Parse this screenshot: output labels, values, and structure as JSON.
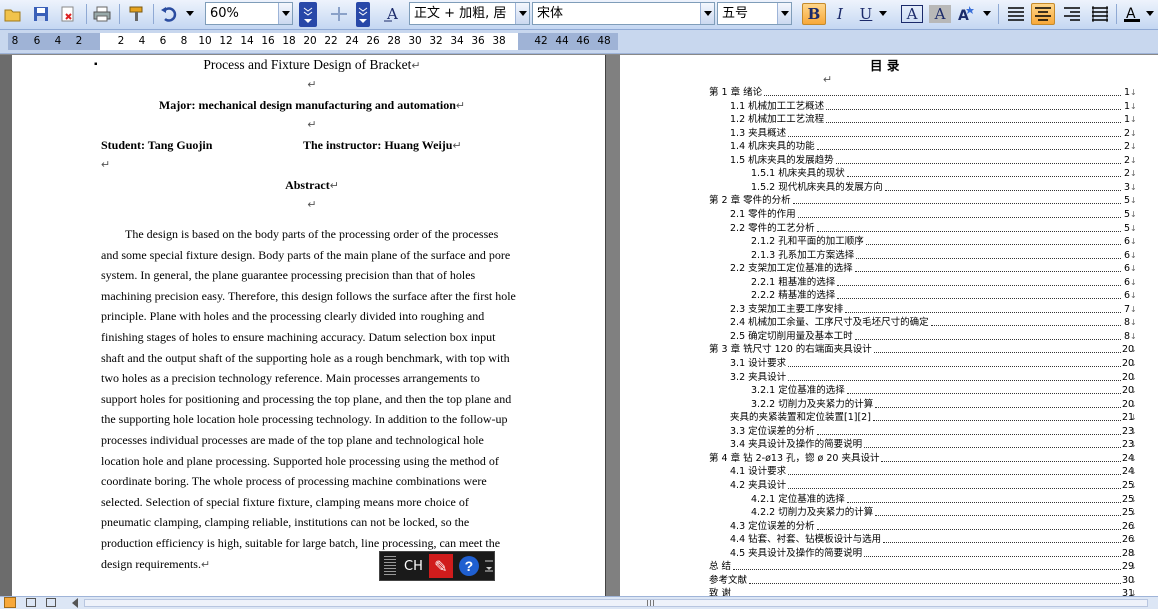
{
  "toolbar": {
    "zoom": "60%",
    "style": "正文 + 加粗, 居",
    "font": "宋体",
    "size": "五号",
    "bold_label": "B",
    "italic_label": "I",
    "underline_label": "U",
    "char_border_label": "A",
    "char_shade_label": "A",
    "font_color_label": "A"
  },
  "ruler": {
    "ticks": [
      "8",
      "6",
      "4",
      "2",
      "2",
      "4",
      "6",
      "8",
      "10",
      "12",
      "14",
      "16",
      "18",
      "20",
      "22",
      "24",
      "26",
      "28",
      "30",
      "32",
      "34",
      "36",
      "38",
      "42",
      "44",
      "46",
      "48"
    ]
  },
  "left_page": {
    "bullet": "▪",
    "title": "Process and Fixture Design of   Bracket",
    "major": "Major: mechanical design manufacturing and automation",
    "student": "Student: Tang Guojin",
    "instructor": "The instructor: Huang Weiju",
    "abstract_heading": "Abstract",
    "para_mark": "↵",
    "abstract_lines": [
      "The design is based on the body parts of the processing order of the processes",
      "and some special fixture design. Body parts of the main plane of the surface and pore",
      "system. In general, the plane guarantee processing precision than that of holes",
      "machining precision easy. Therefore, this design follows the surface after the first hole",
      "principle. Plane with holes and the processing clearly divided into roughing and",
      "finishing stages of holes to ensure machining accuracy. Datum selection box input",
      "shaft and the output shaft of the supporting hole as a rough benchmark, with top with",
      "two holes as a precision technology reference. Main processes arrangements to",
      "support holes for positioning and processing the top plane, and then the top plane and",
      "the supporting hole location hole processing technology. In addition to the follow-up",
      "processes individual processes are made of the top plane and technological hole",
      "location hole and plane processing. Supported hole processing using the method of",
      "coordinate boring. The whole process of processing machine combinations were",
      "selected. Selection of special fixture fixture, clamping means more choice of",
      "pneumatic clamping, clamping reliable, institutions can not be locked, so the",
      "production efficiency is high, suitable for large batch, line processing, can meet the",
      "design requirements."
    ]
  },
  "right_page": {
    "toc_title": "目    录",
    "toc": [
      {
        "text": "第 1 章  绪论",
        "page": "1"
      },
      {
        "text": "1.1  机械加工工艺概述",
        "page": "1"
      },
      {
        "text": "1.2 机械加工工艺流程",
        "page": "1"
      },
      {
        "text": "1.3 夹具概述",
        "page": "2"
      },
      {
        "text": "1.4 机床夹具的功能",
        "page": "2"
      },
      {
        "text": "1.5 机床夹具的发展趋势",
        "page": "2"
      },
      {
        "text": "1.5.1 机床夹具的现状",
        "page": "2"
      },
      {
        "text": "1.5.2 现代机床夹具的发展方向",
        "page": "3"
      },
      {
        "text": "第 2 章  零件的分析",
        "page": "5"
      },
      {
        "text": "2.1  零件的作用",
        "page": "5"
      },
      {
        "text": "2.2  零件的工艺分析",
        "page": "5"
      },
      {
        "text": "2.1.2  孔和平面的加工顺序",
        "page": "6"
      },
      {
        "text": "2.1.3  孔系加工方案选择",
        "page": "6"
      },
      {
        "text": "2.2  支架加工定位基准的选择",
        "page": "6"
      },
      {
        "text": "2.2.1  粗基准的选择",
        "page": "6"
      },
      {
        "text": "2.2.2  精基准的选择",
        "page": "6"
      },
      {
        "text": "2.3  支架加工主要工序安排",
        "page": "7"
      },
      {
        "text": "2.4     机械加工余量、工序尺寸及毛坯尺寸的确定",
        "page": "8"
      },
      {
        "text": "2.5     确定切削用量及基本工时",
        "page": "8"
      },
      {
        "text": "第 3 章  铣尺寸 120 的右端面夹具设计",
        "page": "20"
      },
      {
        "text": "3.1 设计要求",
        "page": "20"
      },
      {
        "text": "3.2 夹具设计",
        "page": "20"
      },
      {
        "text": "3.2.1     定位基准的选择",
        "page": "20"
      },
      {
        "text": "3.2.2     切削力及夹紧力的计算",
        "page": "20"
      },
      {
        "text": "夹具的夹紧装置和定位装置[1][2]",
        "page": "21"
      },
      {
        "text": "3.3 定位误差的分析",
        "page": "23"
      },
      {
        "text": "3.4 夹具设计及操作的简要说明",
        "page": "23"
      },
      {
        "text": "第 4 章  钻 2-ø13 孔，锪 ø 20 夹具设计",
        "page": "24"
      },
      {
        "text": "4.1 设计要求",
        "page": "24"
      },
      {
        "text": "4.2 夹具设计",
        "page": "25"
      },
      {
        "text": "4.2.1     定位基准的选择",
        "page": "25"
      },
      {
        "text": "4.2.2     切削力及夹紧力的计算",
        "page": "25"
      },
      {
        "text": "4.3 定位误差的分析",
        "page": "26"
      },
      {
        "text": "4.4  钻套、衬套、钻模板设计与选用",
        "page": "26"
      },
      {
        "text": "4.5 夹具设计及操作的简要说明",
        "page": "28"
      },
      {
        "text": "总  结",
        "page": "29"
      },
      {
        "text": "参考文献",
        "page": "30"
      },
      {
        "text": "致  谢",
        "page": "31"
      }
    ]
  },
  "langbar": {
    "label": "CH"
  },
  "colors": {
    "accent": "#f7a83a",
    "toolbar": "#c4d7f2",
    "page": "#ffffff",
    "gray": "#808080"
  }
}
